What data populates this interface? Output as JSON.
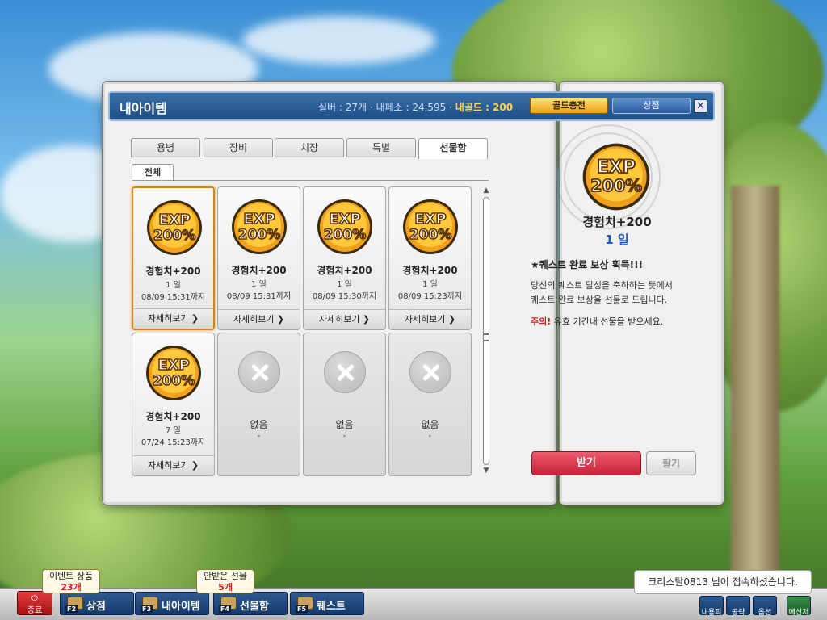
{
  "window": {
    "title": "내아이템",
    "silver": "실버 : 27개",
    "mesos": "내페소 : 24,595",
    "gold": "내골드 : 200",
    "charge_button": "골드충전",
    "shop_button": "상점",
    "close_button": "✕"
  },
  "tabs": [
    "용병",
    "장비",
    "치장",
    "특별",
    "선물함"
  ],
  "active_tab": "선물함",
  "subtab": "전체",
  "items": [
    {
      "name": "경험치+200",
      "duration": "1 일",
      "expiry": "08/09 15:31까지",
      "detail": "자세히보기 ❯",
      "selected": true
    },
    {
      "name": "경험치+200",
      "duration": "1 일",
      "expiry": "08/09 15:31까지",
      "detail": "자세히보기 ❯",
      "selected": false
    },
    {
      "name": "경험치+200",
      "duration": "1 일",
      "expiry": "08/09 15:30까지",
      "detail": "자세히보기 ❯",
      "selected": false
    },
    {
      "name": "경험치+200",
      "duration": "1 일",
      "expiry": "08/09 15:23까지",
      "detail": "자세히보기 ❯",
      "selected": false
    },
    {
      "name": "경험치+200",
      "duration": "7 일",
      "expiry": "07/24 15:23까지",
      "detail": "자세히보기 ❯",
      "selected": false
    }
  ],
  "empty_slots": [
    {
      "label": "없음",
      "dash": "-"
    },
    {
      "label": "없음",
      "dash": "-"
    },
    {
      "label": "없음",
      "dash": "-"
    }
  ],
  "icon_text": {
    "top": "EXP",
    "bottom": "200%"
  },
  "detail": {
    "name": "경험치+200",
    "duration": "1 일",
    "reward": "★퀘스트 완료 보상 획득!!!",
    "desc_line1": "당신의 퀘스트 달성을 축하하는 뜻에서",
    "desc_line2": "퀘스트 완료 보상을 선물로 드립니다.",
    "warn_label": "주의!",
    "warn_text": " 유효 기간내 선물을 받으세요.",
    "receive_button": "받기",
    "sell_button": "팔기"
  },
  "taskbar": {
    "quit": "종료",
    "shop": {
      "key": "F2",
      "label": "상점"
    },
    "myitem": {
      "key": "F3",
      "label": "내아이템"
    },
    "giftbox": {
      "key": "F4",
      "label": "선물함"
    },
    "quest": {
      "key": "F5",
      "label": "퀘스트"
    },
    "event_bubble": {
      "title": "이벤트 상품",
      "count": "23개"
    },
    "gift_bubble": {
      "title": "안받은 선물",
      "count": "5개"
    },
    "small_buttons": [
      "내용피",
      "공략",
      "옵션",
      "메신저"
    ]
  },
  "notice": "크리스탈0813 님이 접속하셨습니다.",
  "colors": {
    "accent": "#1e4f86",
    "gold": "#ffd34a",
    "receive": "#c52339",
    "selected_border": "#d7831c"
  }
}
